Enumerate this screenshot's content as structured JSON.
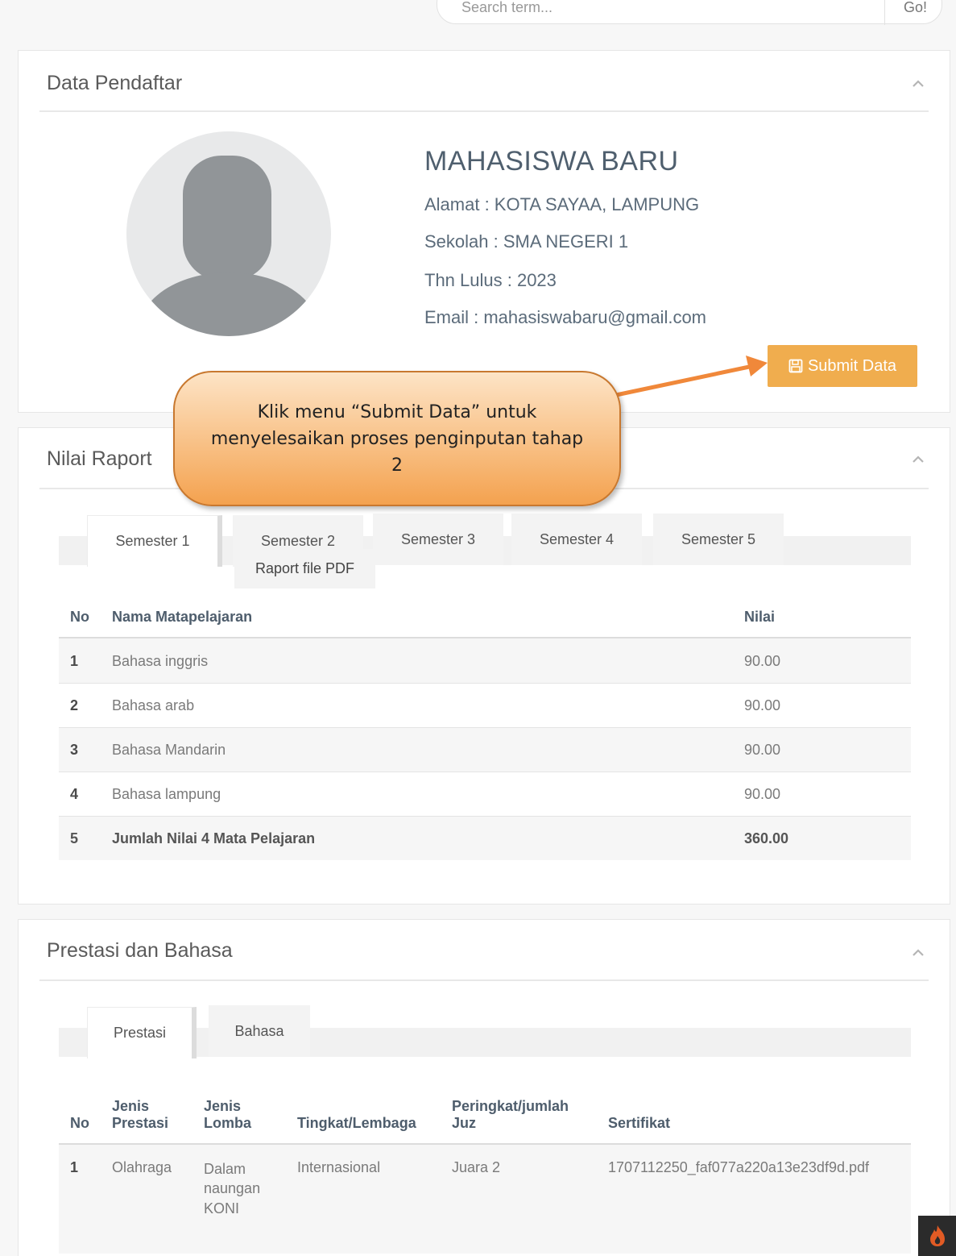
{
  "search": {
    "placeholder": "Search term...",
    "button_label": "Go!"
  },
  "panel_profile": {
    "title": "Data Pendaftar",
    "name": "MAHASISWA BARU",
    "alamat": "Alamat : KOTA SAYAA, LAMPUNG",
    "sekolah": "Sekolah : SMA NEGERI 1",
    "lulus": "Thn Lulus : 2023",
    "email": "Email : mahasiswabaru@gmail.com",
    "submit_label": "Submit Data",
    "submit_icon": "floppy-disk-icon"
  },
  "callout": {
    "text": "Klik menu “Submit Data” untuk menyelesaikan proses penginputan tahap 2"
  },
  "panel_raport": {
    "title": "Nilai Raport",
    "tabs": [
      "Semester 1",
      "Semester 2",
      "Semester 3",
      "Semester 4",
      "Semester 5"
    ],
    "active_tab": "Semester 1",
    "dropdown_item": "Raport file PDF",
    "headers": {
      "no": "No",
      "mapel": "Nama Matapelajaran",
      "nilai": "Nilai"
    },
    "rows": [
      {
        "no": "1",
        "mapel": "Bahasa inggris",
        "nilai": "90.00"
      },
      {
        "no": "2",
        "mapel": "Bahasa arab",
        "nilai": "90.00"
      },
      {
        "no": "3",
        "mapel": "Bahasa Mandarin",
        "nilai": "90.00"
      },
      {
        "no": "4",
        "mapel": "Bahasa lampung",
        "nilai": "90.00"
      },
      {
        "no": "5",
        "mapel": "Jumlah Nilai 4 Mata Pelajaran",
        "nilai": "360.00"
      }
    ]
  },
  "panel_prestasi": {
    "title": "Prestasi dan Bahasa",
    "tabs": [
      "Prestasi",
      "Bahasa"
    ],
    "active_tab": "Prestasi",
    "headers": {
      "no": "No",
      "jenis_prestasi": "Jenis Prestasi",
      "jenis_lomba": "Jenis Lomba",
      "tingkat": "Tingkat/Lembaga",
      "peringkat": "Peringkat/jumlah Juz",
      "sertifikat": "Sertifikat"
    },
    "rows": [
      {
        "no": "1",
        "jenis_prestasi": "Olahraga",
        "jenis_lomba": "Dalam naungan KONI",
        "tingkat": "Internasional",
        "peringkat": "Juara 2",
        "sertifikat": "1707112250_faf077a220a13e23df9d.pdf"
      }
    ]
  },
  "colors": {
    "accent_orange": "#f0ad4e",
    "callout_top": "#fde4c6",
    "callout_bottom": "#f4a24f",
    "arrow": "#f0883a"
  },
  "corner_icon": "flame-icon"
}
